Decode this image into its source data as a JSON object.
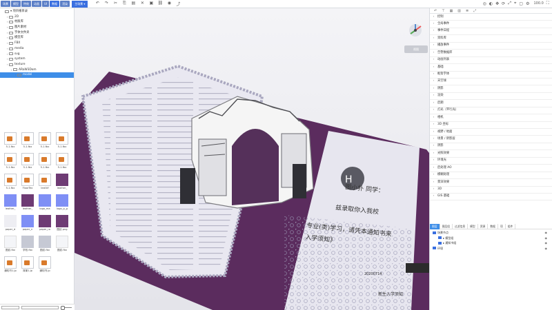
{
  "toolbar": {
    "tabs": [
      "场景",
      "模型",
      "特效",
      "动画",
      "UI",
      "数据",
      "渲染"
    ],
    "scene_dropdown": "主场景 ▾",
    "tool_icons": [
      "undo-icon",
      "redo-icon",
      "cut-icon",
      "copy-icon",
      "paste-icon",
      "delete-icon",
      "group-icon",
      "link-icon",
      "camera-icon",
      "export-icon"
    ],
    "right_icons": [
      "globe-icon",
      "view-icon",
      "move-icon",
      "rotate-icon",
      "scale-icon",
      "snap-icon",
      "cube-icon",
      "settings-icon",
      "fullscreen-icon"
    ],
    "zoom": "100.0"
  },
  "tree": [
    {
      "label": "▾ 项目根目录",
      "indent": 0,
      "open": true
    },
    {
      "label": "2D",
      "indent": 1
    },
    {
      "label": "材质库",
      "indent": 1
    },
    {
      "label": "图片素材",
      "indent": 1
    },
    {
      "label": "字体文件夹",
      "indent": 1
    },
    {
      "label": "模型库",
      "indent": 1
    },
    {
      "label": "FBX",
      "indent": 1
    },
    {
      "label": "media",
      "indent": 1
    },
    {
      "label": "svg",
      "indent": 1
    },
    {
      "label": "system",
      "indent": 1
    },
    {
      "label": "texture",
      "indent": 1
    },
    {
      "label": "ARaW3Dom",
      "indent": 2
    },
    {
      "label": "model",
      "indent": 3,
      "selected": true
    }
  ],
  "assets": [
    {
      "label": "5-1.fbx",
      "type": "file"
    },
    {
      "label": "5-1.fbx",
      "type": "file"
    },
    {
      "label": "5-1.fbx",
      "type": "file"
    },
    {
      "label": "5-1.fbx",
      "type": "file"
    },
    {
      "label": "5-1.fbx",
      "type": "file"
    },
    {
      "label": "5-1.fbx",
      "type": "file"
    },
    {
      "label": "5-1.fbx",
      "type": "file"
    },
    {
      "label": "5-1.fbx",
      "type": "file"
    },
    {
      "label": "5-1.fbx",
      "type": "file"
    },
    {
      "label": "FloorTex",
      "type": "file"
    },
    {
      "label": "leaf.tif",
      "type": "file"
    },
    {
      "label": "leather_",
      "type": "purple"
    },
    {
      "label": "leather_",
      "type": "blue"
    },
    {
      "label": "leather_",
      "type": "purple"
    },
    {
      "label": "logo_ma",
      "type": "blue"
    },
    {
      "label": "logo_p_g",
      "type": "blue"
    },
    {
      "label": "paper_d",
      "type": "paper"
    },
    {
      "label": "paper_n",
      "type": "blue"
    },
    {
      "label": "paper_ro",
      "type": "purple"
    },
    {
      "label": "图纹.png",
      "type": "purple"
    },
    {
      "label": "图纹.fbx",
      "type": "light"
    },
    {
      "label": "学校.fbx",
      "type": "gray"
    },
    {
      "label": "图纹.fbx",
      "type": "gray"
    },
    {
      "label": "图纹.fbx",
      "type": "light"
    },
    {
      "label": "通知书1.jp",
      "type": "file"
    },
    {
      "label": "背景1.jp",
      "type": "file"
    },
    {
      "label": "通知书.jp",
      "type": "file"
    }
  ],
  "viewport": {
    "view_button": "视图",
    "letter": {
      "name_line": "图小扑 同学：",
      "line2": "兹录取你入我校",
      "line3": "专业(类)学习，请凭本通知书来",
      "line4": "入学须知》",
      "number": "20200714",
      "footer": "新生入学须知"
    }
  },
  "components": [
    "控制",
    "全局事件",
    "事件日程",
    "资料库",
    "播放事件",
    "告警数据库",
    "动画列表",
    "基础",
    "框架字体",
    "天空球",
    "阴影",
    "渲染",
    "后期",
    "灯光（平行光）",
    "相机",
    "3D 坐标",
    "视野 / 地面",
    "场景 / 阴影层",
    "阴影",
    "光照效果",
    "环境光",
    "后处理 AO",
    "模糊处理",
    "景深效果",
    "3D",
    "GIS 基础"
  ],
  "bottom_tabs": [
    "图层",
    "图层组",
    "过滤信息",
    "模型",
    "资源",
    "数据",
    "项",
    "组件"
  ],
  "layers": [
    {
      "label": "场景节点",
      "depth": 0
    },
    {
      "label": "▸ 模型组",
      "depth": 1
    },
    {
      "label": "▸ 通知书组",
      "depth": 1
    },
    {
      "label": "环境",
      "depth": 0
    }
  ]
}
